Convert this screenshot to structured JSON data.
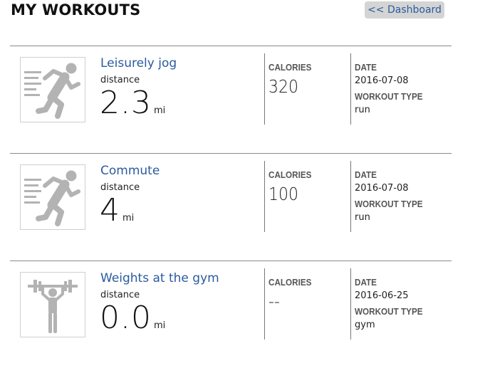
{
  "header": {
    "title": "MY WORKOUTS",
    "dashboard_link": "<< Dashboard"
  },
  "labels": {
    "distance": "distance",
    "calories": "CALORIES",
    "date": "DATE",
    "workout_type": "WORKOUT TYPE"
  },
  "workouts": [
    {
      "name": "Leisurely jog",
      "distance": "2.3",
      "unit": "mi",
      "calories": "320",
      "date": "2016-07-08",
      "type": "run",
      "icon": "running-person-icon"
    },
    {
      "name": "Commute",
      "distance": "4",
      "unit": "mi",
      "calories": "100",
      "date": "2016-07-08",
      "type": "run",
      "icon": "running-person-icon"
    },
    {
      "name": "Weights at the gym",
      "distance": "0.0",
      "unit": "mi",
      "calories": "--",
      "date": "2016-06-25",
      "type": "gym",
      "icon": "weightlifter-icon"
    }
  ]
}
